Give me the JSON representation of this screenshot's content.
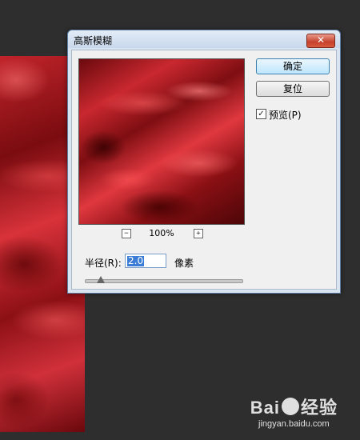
{
  "watermark": {
    "brand_left": "Bai",
    "brand_right": "经验",
    "url": "jingyan.baidu.com"
  },
  "dialog": {
    "title": "高斯模糊",
    "close_glyph": "✕",
    "buttons": {
      "ok": "确定",
      "reset": "复位"
    },
    "preview_checkbox": {
      "label": "预览(P)",
      "checked": true,
      "check_glyph": "✓"
    },
    "zoom": {
      "minus": "−",
      "plus": "+",
      "value": "100%"
    },
    "radius": {
      "label": "半径(R):",
      "value": "2.0",
      "unit": "像素"
    },
    "slider": {
      "position_fraction": 0.1
    }
  }
}
